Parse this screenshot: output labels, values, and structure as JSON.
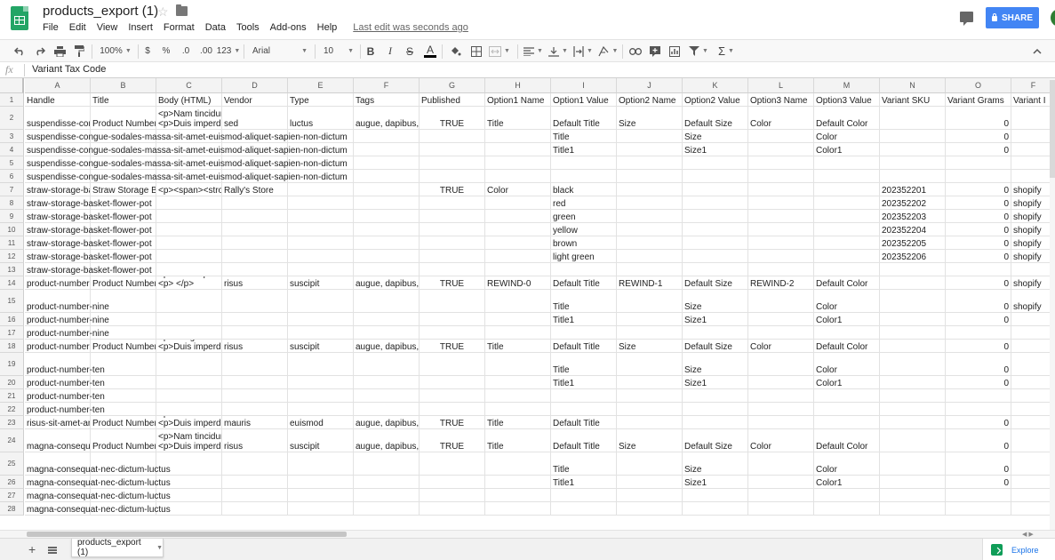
{
  "app": {
    "doc_title": "products_export (1)",
    "last_edit": "Last edit was seconds ago",
    "share_label": "SHARE",
    "menu": [
      "File",
      "Edit",
      "View",
      "Insert",
      "Format",
      "Data",
      "Tools",
      "Add-ons",
      "Help"
    ],
    "brand_color": "#23a566",
    "accent_color": "#4285f4"
  },
  "toolbar": {
    "zoom": "100%",
    "currency": "$",
    "percent": "%",
    "dec_decrease": ".0",
    "dec_increase": ".00",
    "more_formats": "123",
    "font": "Arial",
    "font_size": "10",
    "bold": "B",
    "italic": "I",
    "strike": "S",
    "text_color": "A",
    "text_color_swatch": "#000000",
    "icons": [
      "undo-icon",
      "redo-icon",
      "print-icon",
      "paint-format-icon",
      "fill-color-icon",
      "borders-icon",
      "merge-cells-icon",
      "align-icon",
      "valign-icon",
      "wrap-icon",
      "rotate-icon",
      "link-icon",
      "comment-icon",
      "chart-icon",
      "filter-icon",
      "functions-icon",
      "collapse-icon"
    ]
  },
  "formula": {
    "label": "fx",
    "value": "Variant Tax Code"
  },
  "columns": [
    "A",
    "B",
    "C",
    "D",
    "E",
    "F",
    "G",
    "H",
    "I",
    "J",
    "K",
    "L",
    "M",
    "N",
    "O",
    "F"
  ],
  "rows": [
    [
      "Handle",
      "Title",
      "Body (HTML)",
      "Vendor",
      "Type",
      "Tags",
      "Published",
      "Option1 Name",
      "Option1 Value",
      "Option2 Name",
      "Option2 Value",
      "Option3 Name",
      "Option3 Value",
      "Variant SKU",
      "Variant Grams",
      "Variant I"
    ],
    [
      "suspendisse-con",
      "Product Number",
      "<p>Nam tincidun\n<p>Duis imperdie",
      "sed",
      "luctus",
      "augue, dapibus,",
      "TRUE",
      "Title",
      "Default Title",
      "Size",
      "Default Size",
      "Color",
      "Default Color",
      "",
      "0",
      ""
    ],
    [
      "suspendisse-congue-sodales-massa-sit-amet-euismod-aliquet-sapien-non-dictum",
      "",
      "",
      "",
      "",
      "",
      "",
      "",
      "Title",
      "",
      "Size",
      "",
      "Color",
      "",
      "0",
      ""
    ],
    [
      "suspendisse-congue-sodales-massa-sit-amet-euismod-aliquet-sapien-non-dictum",
      "",
      "",
      "",
      "",
      "",
      "",
      "",
      "Title1",
      "",
      "Size1",
      "",
      "Color1",
      "",
      "0",
      ""
    ],
    [
      "suspendisse-congue-sodales-massa-sit-amet-euismod-aliquet-sapien-non-dictum",
      "",
      "",
      "",
      "",
      "",
      "",
      "",
      "",
      "",
      "",
      "",
      "",
      "",
      "",
      ""
    ],
    [
      "suspendisse-congue-sodales-massa-sit-amet-euismod-aliquet-sapien-non-dictum",
      "",
      "",
      "",
      "",
      "",
      "",
      "",
      "",
      "",
      "",
      "",
      "",
      "",
      "",
      ""
    ],
    [
      "straw-storage-ba",
      "Straw Storage Ba",
      "<p><span><stro",
      "Rally's Store",
      "",
      "",
      "TRUE",
      "Color",
      "black",
      "",
      "",
      "",
      "",
      "202352201",
      "0",
      "shopify"
    ],
    [
      "straw-storage-basket-flower-pot",
      "",
      "",
      "",
      "",
      "",
      "",
      "",
      "red",
      "",
      "",
      "",
      "",
      "202352202",
      "0",
      "shopify"
    ],
    [
      "straw-storage-basket-flower-pot",
      "",
      "",
      "",
      "",
      "",
      "",
      "",
      "green",
      "",
      "",
      "",
      "",
      "202352203",
      "0",
      "shopify"
    ],
    [
      "straw-storage-basket-flower-pot",
      "",
      "",
      "",
      "",
      "",
      "",
      "",
      "yellow",
      "",
      "",
      "",
      "",
      "202352204",
      "0",
      "shopify"
    ],
    [
      "straw-storage-basket-flower-pot",
      "",
      "",
      "",
      "",
      "",
      "",
      "",
      "brown",
      "",
      "",
      "",
      "",
      "202352205",
      "0",
      "shopify"
    ],
    [
      "straw-storage-basket-flower-pot",
      "",
      "",
      "",
      "",
      "",
      "",
      "",
      "light green",
      "",
      "",
      "",
      "",
      "202352206",
      "0",
      "shopify"
    ],
    [
      "straw-storage-basket-flower-pot",
      "",
      "",
      "",
      "",
      "",
      "",
      "",
      "",
      "",
      "",
      "",
      "",
      "",
      "",
      ""
    ],
    [
      "product-number-",
      "Product Number",
      "<p>Duis imperdi\n<p> </p>",
      "risus",
      "suscipit",
      "augue, dapibus,",
      "TRUE",
      "REWIND-0",
      "Default Title",
      "REWIND-1",
      "Default Size",
      "REWIND-2",
      "Default Color",
      "",
      "0",
      "shopify"
    ],
    [
      "product-number-nine",
      "",
      "",
      "",
      "",
      "",
      "",
      "",
      "Title",
      "",
      "Size",
      "",
      "Color",
      "",
      "0",
      "shopify"
    ],
    [
      "product-number-nine",
      "",
      "",
      "",
      "",
      "",
      "",
      "",
      "Title1",
      "",
      "Size1",
      "",
      "Color1",
      "",
      "0",
      ""
    ],
    [
      "product-number-nine",
      "",
      "",
      "",
      "",
      "",
      "",
      "",
      "",
      "",
      "",
      "",
      "",
      "",
      "",
      ""
    ],
    [
      "product-number-",
      "Product Number",
      "<p>Congue soda\n<p>Duis imperdi",
      "risus",
      "suscipit",
      "augue, dapibus,",
      "TRUE",
      "Title",
      "Default Title",
      "Size",
      "Default Size",
      "Color",
      "Default Color",
      "",
      "0",
      ""
    ],
    [
      "product-number-ten",
      "",
      "",
      "",
      "",
      "",
      "",
      "",
      "Title",
      "",
      "Size",
      "",
      "Color",
      "",
      "0",
      ""
    ],
    [
      "product-number-ten",
      "",
      "",
      "",
      "",
      "",
      "",
      "",
      "Title1",
      "",
      "Size1",
      "",
      "Color1",
      "",
      "0",
      ""
    ],
    [
      "product-number-ten",
      "",
      "",
      "",
      "",
      "",
      "",
      "",
      "",
      "",
      "",
      "",
      "",
      "",
      "",
      ""
    ],
    [
      "product-number-ten",
      "",
      "",
      "",
      "",
      "",
      "",
      "",
      "",
      "",
      "",
      "",
      "",
      "",
      "",
      ""
    ],
    [
      "risus-sit-amet-an",
      "Product Number",
      "<p>Nam tincidun\n<p>Duis imperdi",
      "mauris",
      "euismod",
      "augue, dapibus,",
      "TRUE",
      "Title",
      "Default Title",
      "",
      "",
      "",
      "",
      "",
      "0",
      ""
    ],
    [
      "magna-consequa",
      "Product Number",
      "<p>Nam tincidun\n<p>Duis imperdi",
      "risus",
      "suscipit",
      "augue, dapibus,",
      "TRUE",
      "Title",
      "Default Title",
      "Size",
      "Default Size",
      "Color",
      "Default Color",
      "",
      "0",
      ""
    ],
    [
      "magna-consequat-nec-dictum-luctus",
      "",
      "",
      "",
      "",
      "",
      "",
      "",
      "Title",
      "",
      "Size",
      "",
      "Color",
      "",
      "0",
      ""
    ],
    [
      "magna-consequat-nec-dictum-luctus",
      "",
      "",
      "",
      "",
      "",
      "",
      "",
      "Title1",
      "",
      "Size1",
      "",
      "Color1",
      "",
      "0",
      ""
    ],
    [
      "magna-consequat-nec-dictum-luctus",
      "",
      "",
      "",
      "",
      "",
      "",
      "",
      "",
      "",
      "",
      "",
      "",
      "",
      "",
      ""
    ],
    [
      "magna-consequat-nec-dictum-luctus",
      "",
      "",
      "",
      "",
      "",
      "",
      "",
      "",
      "",
      "",
      "",
      "",
      "",
      "",
      ""
    ]
  ],
  "sheet_tab": "products_export (1)",
  "explore_label": "Explore"
}
